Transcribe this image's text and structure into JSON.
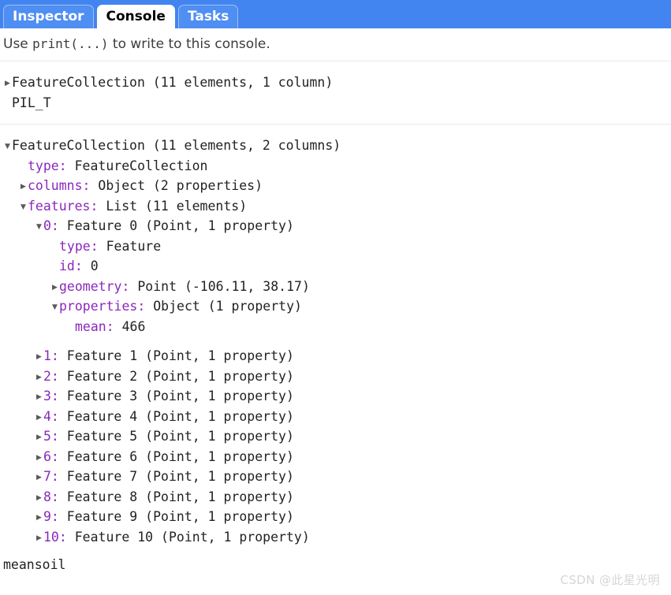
{
  "tabs": [
    {
      "label": "Inspector",
      "active": false
    },
    {
      "label": "Console",
      "active": true
    },
    {
      "label": "Tasks",
      "active": false
    }
  ],
  "hint": {
    "before": "Use ",
    "code": "print(...)",
    "after": " to write to this console."
  },
  "blocks": [
    {
      "id": "block-collapsed",
      "lines": [
        {
          "arrow": "collapsed",
          "indent": 0,
          "key": "",
          "value": "FeatureCollection (11 elements, 1 column)"
        },
        {
          "arrow": "none",
          "indent": 0,
          "key": "",
          "value": "PIL_T"
        }
      ]
    },
    {
      "id": "block-expanded",
      "lines": [
        {
          "arrow": "expanded",
          "indent": 0,
          "key": "",
          "value": "FeatureCollection (11 elements, 2 columns)"
        },
        {
          "arrow": "none",
          "indent": 1,
          "key": "type:",
          "value": " FeatureCollection"
        },
        {
          "arrow": "collapsed",
          "indent": 1,
          "key": "columns:",
          "value": " Object (2 properties)"
        },
        {
          "arrow": "expanded",
          "indent": 1,
          "key": "features:",
          "value": " List (11 elements)"
        },
        {
          "arrow": "expanded",
          "indent": 2,
          "key": "0:",
          "value": " Feature 0 (Point, 1 property)"
        },
        {
          "arrow": "none",
          "indent": 3,
          "key": "type:",
          "value": " Feature"
        },
        {
          "arrow": "none",
          "indent": 3,
          "key": "id:",
          "value": " 0"
        },
        {
          "arrow": "collapsed",
          "indent": 3,
          "key": "geometry:",
          "value": " Point (-106.11, 38.17)"
        },
        {
          "arrow": "expanded",
          "indent": 3,
          "key": "properties:",
          "value": " Object (1 property)"
        },
        {
          "arrow": "none",
          "indent": 4,
          "key": "mean:",
          "value": " 466"
        },
        {
          "arrow": "gap",
          "indent": 0,
          "key": "",
          "value": ""
        },
        {
          "arrow": "collapsed",
          "indent": 2,
          "key": "1:",
          "value": " Feature 1 (Point, 1 property)"
        },
        {
          "arrow": "collapsed",
          "indent": 2,
          "key": "2:",
          "value": " Feature 2 (Point, 1 property)"
        },
        {
          "arrow": "collapsed",
          "indent": 2,
          "key": "3:",
          "value": " Feature 3 (Point, 1 property)"
        },
        {
          "arrow": "collapsed",
          "indent": 2,
          "key": "4:",
          "value": " Feature 4 (Point, 1 property)"
        },
        {
          "arrow": "collapsed",
          "indent": 2,
          "key": "5:",
          "value": " Feature 5 (Point, 1 property)"
        },
        {
          "arrow": "collapsed",
          "indent": 2,
          "key": "6:",
          "value": " Feature 6 (Point, 1 property)"
        },
        {
          "arrow": "collapsed",
          "indent": 2,
          "key": "7:",
          "value": " Feature 7 (Point, 1 property)"
        },
        {
          "arrow": "collapsed",
          "indent": 2,
          "key": "8:",
          "value": " Feature 8 (Point, 1 property)"
        },
        {
          "arrow": "collapsed",
          "indent": 2,
          "key": "9:",
          "value": " Feature 9 (Point, 1 property)"
        },
        {
          "arrow": "collapsed",
          "indent": 2,
          "key": "10:",
          "value": " Feature 10 (Point, 1 property)"
        }
      ],
      "tail": "meansoil"
    }
  ],
  "watermark": "CSDN @此星光明",
  "glyphs": {
    "collapsed": "▶",
    "expanded": "▼"
  },
  "colors": {
    "tabbar_blue": "#4285f0",
    "tab_inactive_blue": "#4f8ef2",
    "key_purple": "#8b27bd",
    "text": "#222222",
    "separator": "#eaeaea",
    "watermark": "#d6d6d6"
  }
}
